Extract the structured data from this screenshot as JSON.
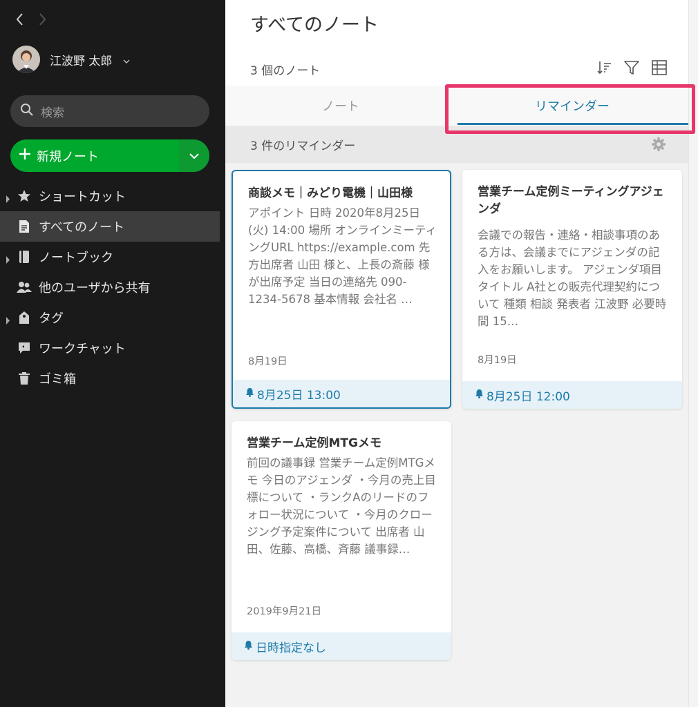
{
  "sidebar": {
    "user_name": "江波野 太郎",
    "search_placeholder": "検索",
    "new_note_label": "新規ノート",
    "items": [
      {
        "label": "ショートカット"
      },
      {
        "label": "すべてのノート"
      },
      {
        "label": "ノートブック"
      },
      {
        "label": "他のユーザから共有"
      },
      {
        "label": "タグ"
      },
      {
        "label": "ワークチャット"
      },
      {
        "label": "ゴミ箱"
      }
    ]
  },
  "main": {
    "title": "すべてのノート",
    "note_count": "3 個のノート",
    "tabs": [
      {
        "label": "ノート"
      },
      {
        "label": "リマインダー"
      }
    ],
    "reminder_count": "3 件のリマインダー"
  },
  "cards": [
    {
      "title": "商談メモ｜みどり電機｜山田様",
      "body": "アポイント 日時 2020年8月25日(火) 14:00 場所 オンラインミーティングURL https://example.com 先方出席者 山田 様と、上長の斎藤 様が出席予定 当日の連絡先 090-1234-5678 基本情報 会社名 …",
      "date": "8月19日",
      "reminder": "8月25日 13:00"
    },
    {
      "title": "営業チーム定例ミーティングアジェンダ",
      "body": "会議での報告・連絡・相談事項のある方は、会議までにアジェンダの記入をお願いします。 アジェンダ項目 タイトル A社との販売代理契約について 種類 相談 発表者 江波野 必要時間 15…",
      "date": "8月19日",
      "reminder": "8月25日 12:00"
    },
    {
      "title": "営業チーム定例MTGメモ",
      "body": " 前回の議事録 営業チーム定例MTGメモ 今日のアジェンダ ・今月の売上目標について ・ランクAのリードのフォロー状況について ・今月のクロージング予定案件について 出席者 山田、佐藤、高橋、斉藤 議事録…",
      "date": "2019年9月21日",
      "reminder": "日時指定なし"
    }
  ]
}
